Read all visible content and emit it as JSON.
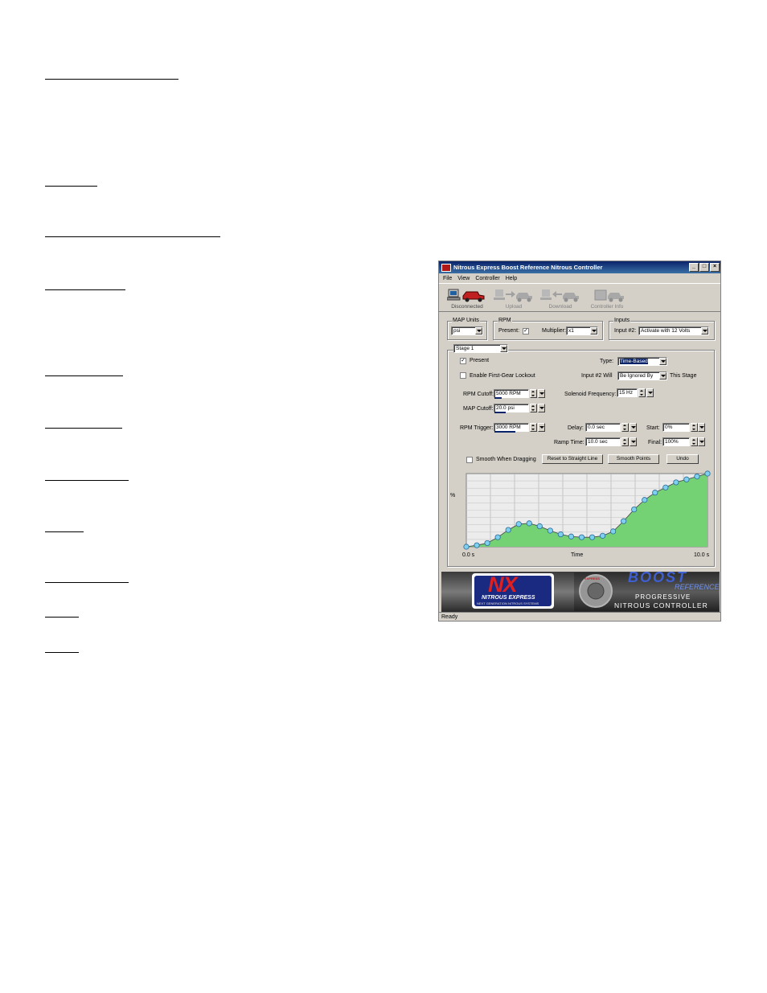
{
  "window": {
    "title": "Nitrous Express Boost Reference Nitrous Controller",
    "menu": [
      "File",
      "View",
      "Controller",
      "Help"
    ],
    "toolbar": [
      "Disconnected",
      "Upload",
      "Download",
      "Controller Info"
    ],
    "status": "Ready"
  },
  "map_units": {
    "label": "MAP Units",
    "value": "psi"
  },
  "rpm": {
    "label": "RPM",
    "present_label": "Present:",
    "present_checked": true,
    "multiplier_label": "Multiplier:",
    "multiplier_value": "x1"
  },
  "inputs": {
    "label": "Inputs",
    "input2_label": "Input #2:",
    "input2_value": "Activate with 12 Volts"
  },
  "stage": {
    "select": "Stage 1",
    "present_label": "Present",
    "present_checked": true,
    "type_label": "Type:",
    "type_value": "Time-Based",
    "lockout_label": "Enable First-Gear Lockout",
    "lockout_checked": false,
    "input2_will_label": "Input #2 Will",
    "input2_will_value": "Be Ignored By",
    "this_stage_label": "This Stage",
    "rpm_cutoff_label": "RPM Cutoff:",
    "rpm_cutoff_value": "5000 RPM",
    "map_cutoff_label": "MAP Cutoff:",
    "map_cutoff_value": "20.0 psi",
    "solenoid_label": "Solenoid Frequency:",
    "solenoid_value": "15 Hz",
    "rpm_trigger_label": "RPM Trigger:",
    "rpm_trigger_value": "3000 RPM",
    "delay_label": "Delay:",
    "delay_value": "0.0 sec",
    "start_label": "Start:",
    "start_value": "0%",
    "ramp_label": "Ramp Time:",
    "ramp_value": "10.0 sec",
    "final_label": "Final:",
    "final_value": "100%",
    "smooth_drag_label": "Smooth When Dragging",
    "smooth_drag_checked": false,
    "reset_button": "Reset to Straight Line",
    "smooth_button": "Smooth Points",
    "undo_button": "Undo"
  },
  "chart_data": {
    "type": "area",
    "ylabel": "%",
    "xlabel": "Time",
    "x_start_label": "0.0 s",
    "x_end_label": "10.0 s",
    "xlim": [
      0,
      10
    ],
    "ylim": [
      0,
      100
    ],
    "grid": true,
    "color": "#74d274",
    "point_color": "#7fd0ee",
    "x": [
      0,
      0.5,
      1.0,
      1.5,
      2.0,
      2.5,
      3.0,
      3.5,
      4.0,
      4.5,
      5.0,
      5.5,
      6.0,
      6.5,
      7.0,
      7.5,
      8.0,
      8.5,
      9.0,
      9.5,
      10.0
    ],
    "values": [
      0,
      2,
      5,
      13,
      23,
      31,
      32,
      28,
      22,
      17,
      14,
      13,
      13,
      15,
      21,
      35,
      51,
      64,
      74,
      81,
      88,
      92,
      96,
      100
    ]
  },
  "banner": {
    "brand": "NX",
    "brand_sub": "NITROUS EXPRESS",
    "tagline": "NEXT GENERATION NITROUS SYSTEMS",
    "badge": "EXPRESS",
    "product": "BOOST",
    "product_sub": "REFERENCE",
    "line1": "PROGRESSIVE",
    "line2": "NITROUS CONTROLLER"
  }
}
